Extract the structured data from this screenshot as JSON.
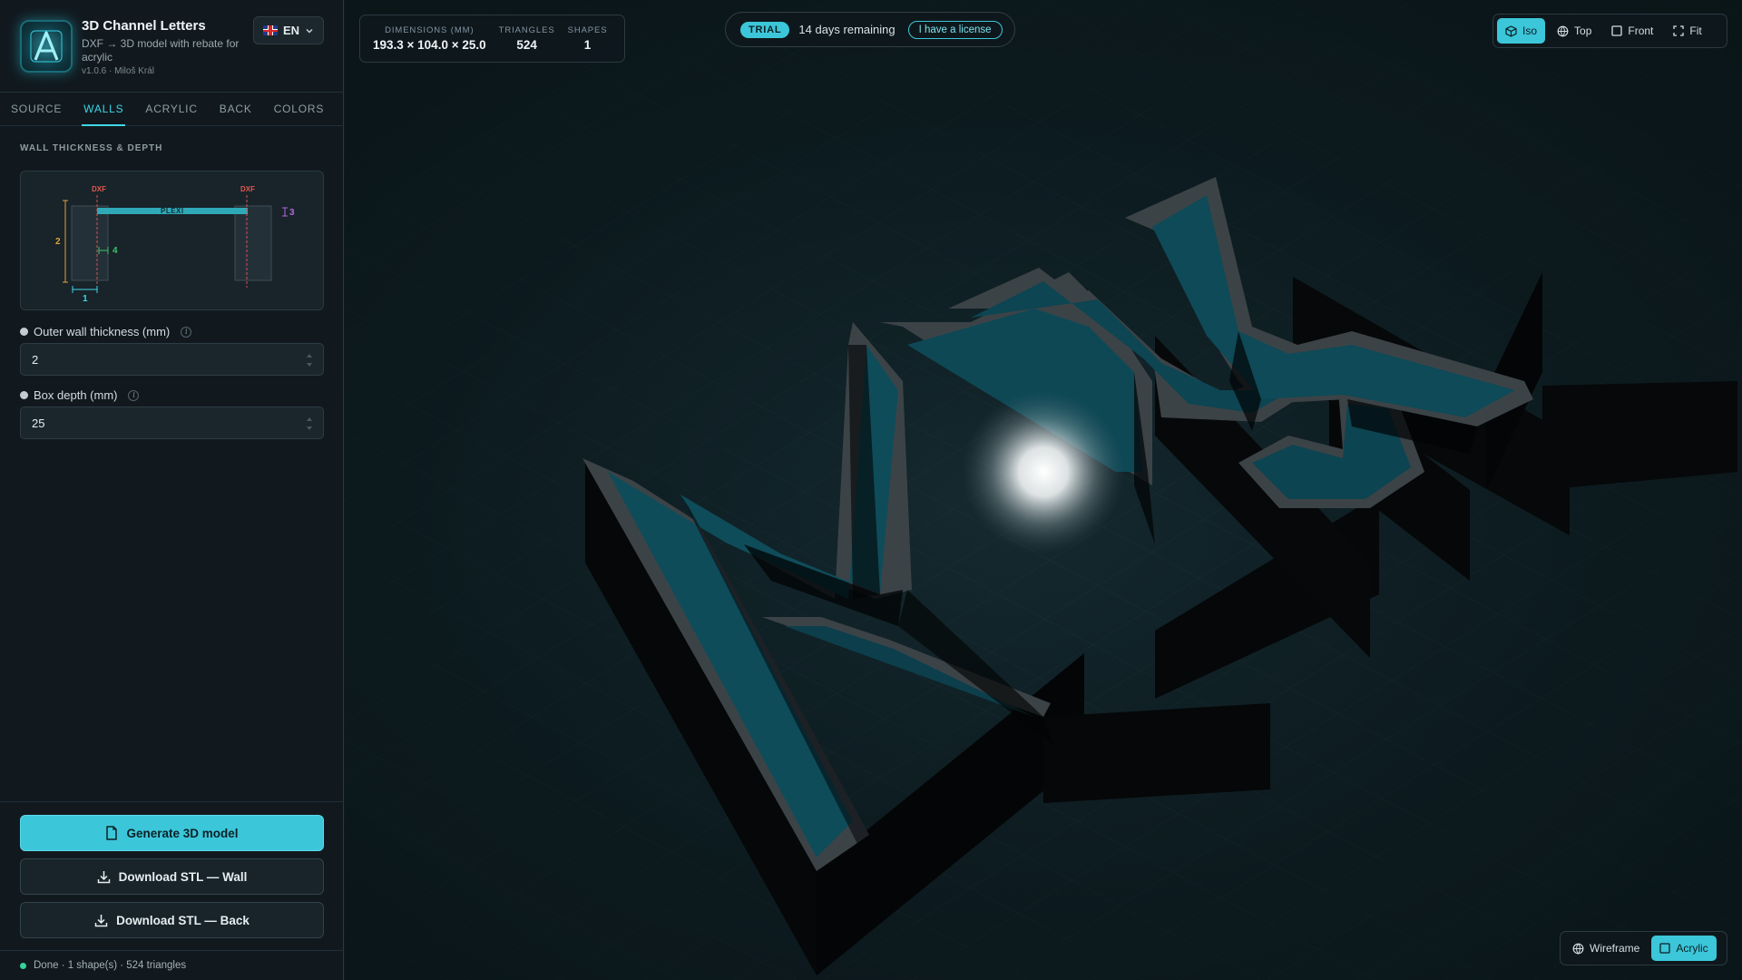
{
  "app": {
    "title": "3D Channel Letters",
    "subtitle": "DXF → 3D model with rebate for acrylic",
    "version": "v1.0.6 · Miloš Král",
    "language": "EN"
  },
  "tabs": [
    {
      "label": "SOURCE",
      "active": false
    },
    {
      "label": "WALLS",
      "active": true
    },
    {
      "label": "ACRYLIC",
      "active": false
    },
    {
      "label": "BACK",
      "active": false
    },
    {
      "label": "COLORS",
      "active": false
    }
  ],
  "section": {
    "title": "WALL THICKNESS & DEPTH"
  },
  "diagram": {
    "dxf_left": "DXF",
    "dxf_right": "DXF",
    "plexi": "PLEXI",
    "dim_2": "2",
    "dim_4": "4",
    "dim_1": "1",
    "dim_3": "3"
  },
  "fields": {
    "outer_wall": {
      "label": "Outer wall thickness (mm)",
      "value": "2"
    },
    "box_depth": {
      "label": "Box depth (mm)",
      "value": "25"
    }
  },
  "actions": {
    "generate": "Generate 3D model",
    "download_wall": "Download STL — Wall",
    "download_back": "Download STL — Back"
  },
  "status": {
    "text": "Done · 1 shape(s) · 524 triangles",
    "color": "#34d399"
  },
  "stats": {
    "dimensions_label": "DIMENSIONS (MM)",
    "dimensions_value": "193.3 × 104.0 × 25.0",
    "triangles_label": "TRIANGLES",
    "triangles_value": "524",
    "shapes_label": "SHAPES",
    "shapes_value": "1"
  },
  "trial": {
    "badge": "TRIAL",
    "text": "14 days remaining",
    "license_button": "I have a license"
  },
  "view_controls": [
    {
      "label": "Iso",
      "icon": "cube-icon",
      "active": true
    },
    {
      "label": "Top",
      "icon": "globe-icon",
      "active": false
    },
    {
      "label": "Front",
      "icon": "square-icon",
      "active": false
    },
    {
      "label": "Fit",
      "icon": "fit-icon",
      "active": false
    }
  ],
  "render_controls": [
    {
      "label": "Wireframe",
      "icon": "globe-icon",
      "active": false
    },
    {
      "label": "Acrylic",
      "icon": "square-icon",
      "active": true
    }
  ],
  "colors": {
    "accent": "#3cc6d9",
    "acrylic": "#0f4c5a",
    "wall": "#050708",
    "rim": "#3c4347"
  }
}
